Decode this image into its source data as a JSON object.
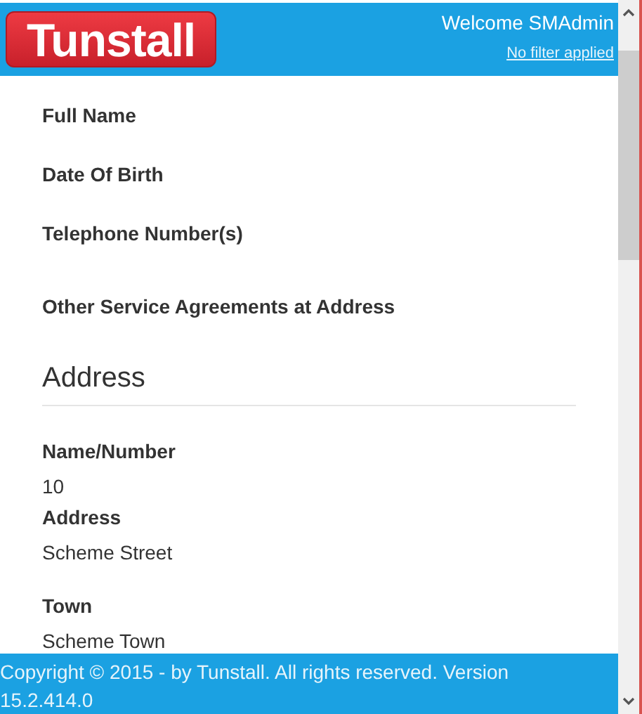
{
  "header": {
    "logo": "Tunstall",
    "welcome": "Welcome SMAdmin",
    "filter_link": "No filter applied"
  },
  "fields": [
    {
      "label": "Full Name"
    },
    {
      "label": "Date Of Birth"
    },
    {
      "label": "Telephone Number(s)"
    },
    {
      "label": "Other Service Agreements at Address"
    }
  ],
  "address": {
    "heading": "Address",
    "fields": [
      {
        "label": "Name/Number",
        "value": "10"
      },
      {
        "label": "Address",
        "value": "Scheme Street"
      },
      {
        "label": "Town",
        "value": "Scheme Town"
      }
    ]
  },
  "footer": {
    "text": "Copyright © 2015 - by Tunstall. All rights reserved. Version 15.2.414.0"
  }
}
